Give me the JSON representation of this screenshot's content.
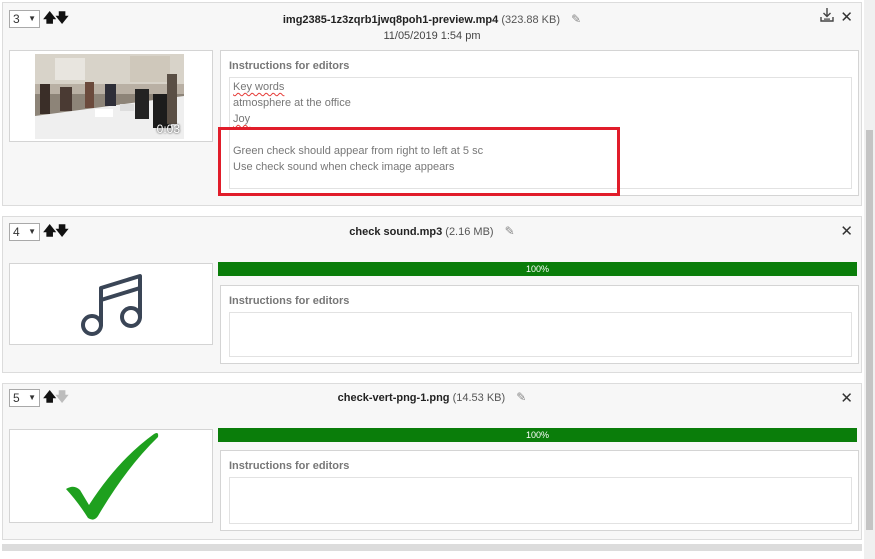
{
  "items": [
    {
      "order": "3",
      "filename": "img2385-1z3zqrb1jwq8poh1-preview.mp4",
      "size": "(323.88 KB)",
      "datetime": "11/05/2019 1:54 pm",
      "duration": "0:03",
      "instructions_title": "Instructions for editors",
      "notes": {
        "keywords": "Key words",
        "atmosphere": "atmosphere at the office",
        "joy": "Joy",
        "line1": "Green check should appear from right to left at 5 sc",
        "line2": "Use check sound when check image appears"
      }
    },
    {
      "order": "4",
      "filename": "check sound.mp3",
      "size": "(2.16 MB)",
      "progress": "100%",
      "instructions_title": "Instructions for editors"
    },
    {
      "order": "5",
      "filename": "check-vert-png-1.png",
      "size": "(14.53 KB)",
      "progress": "100%",
      "instructions_title": "Instructions for editors"
    }
  ],
  "colors": {
    "progress": "#0a7d0a",
    "highlight_box": "#e11d2a",
    "check_mark": "#1ea01e",
    "music_icon": "#3a4556"
  },
  "icons": [
    "up-arrow-icon",
    "down-arrow-icon",
    "edit-icon",
    "download-icon",
    "close-icon",
    "music-note-icon",
    "check-mark-icon"
  ]
}
